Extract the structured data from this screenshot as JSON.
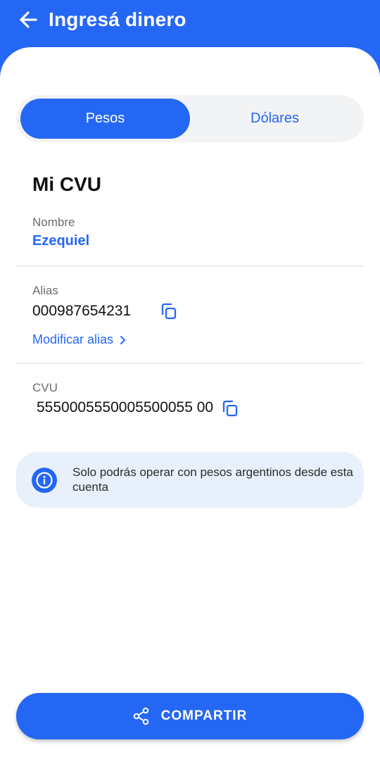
{
  "header": {
    "title": "Ingresá dinero",
    "back_icon": "arrow-left-icon"
  },
  "currency_tabs": [
    {
      "label": "Pesos",
      "selected": true
    },
    {
      "label": "Dólares",
      "selected": false
    }
  ],
  "account": {
    "section_title": "Mi CVU",
    "name_label": "Nombre",
    "name_value": "Ezequiel",
    "alias_label": "Alias",
    "alias_value": "000987654231",
    "modify_alias_label": "Modificar alias",
    "cvu_label": "CVU",
    "cvu_value": "5550005550005500055 00"
  },
  "info": {
    "text": "Solo podrás operar con pesos argentinos desde esta cuenta",
    "icon": "info-icon"
  },
  "share_button": {
    "label": "COMPARTIR",
    "icon": "share-icon"
  },
  "colors": {
    "accent": "#2567f5",
    "info_background": "#e8f0fb"
  }
}
